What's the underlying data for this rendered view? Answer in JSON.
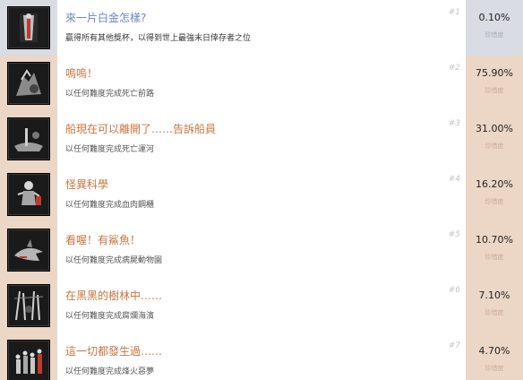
{
  "achievements": [
    {
      "title": "來一片白金怎樣?",
      "description": "贏得所有其他獎杯，以得到世上最強末日倖存者之位",
      "rank": "#1",
      "percent": "0.10%",
      "percent_label": "珍惜度",
      "icon": "platinum-trophy-icon"
    },
    {
      "title": "嗚嗚！",
      "description": "以任何難度完成死亡前路",
      "rank": "#2",
      "percent": "75.90%",
      "percent_label": "珍惜度",
      "icon": "zombie-hand-icon"
    },
    {
      "title": "船現在可以離開了……告訴船員",
      "description": "以任何難度完成死亡運河",
      "rank": "#3",
      "percent": "31.00%",
      "percent_label": "珍惜度",
      "icon": "swamp-boat-icon"
    },
    {
      "title": "怪異科學",
      "description": "以任何難度完成血肉鋼櫃",
      "rank": "#4",
      "percent": "16.20%",
      "percent_label": "珍惜度",
      "icon": "mad-science-icon"
    },
    {
      "title": "看喔！有鯊魚！",
      "description": "以任何難度完成病屍動物園",
      "rank": "#5",
      "percent": "10.70%",
      "percent_label": "珍惜度",
      "icon": "shark-icon"
    },
    {
      "title": "在黑黑的樹林中……",
      "description": "以任何難度完成腐爛海濱",
      "rank": "#6",
      "percent": "7.10%",
      "percent_label": "珍惜度",
      "icon": "dark-woods-icon"
    },
    {
      "title": "這一切都發生過……",
      "description": "以任何難度完成烽火惡夢",
      "rank": "#7",
      "percent": "4.70%",
      "percent_label": "珍惜度",
      "icon": "crowd-figures-icon"
    }
  ]
}
